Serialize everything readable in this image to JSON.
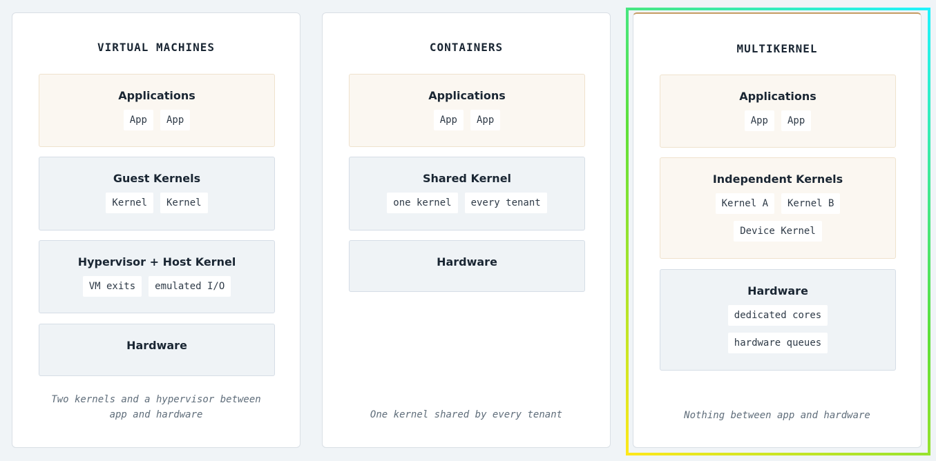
{
  "columns": [
    {
      "title": "VIRTUAL MACHINES",
      "layers": [
        {
          "title": "Applications",
          "chips": [
            "App",
            "App"
          ]
        },
        {
          "title": "Guest Kernels",
          "chips": [
            "Kernel",
            "Kernel"
          ]
        },
        {
          "title": "Hypervisor + Host Kernel",
          "chips": [
            "VM exits",
            "emulated I/O"
          ]
        },
        {
          "title": "Hardware",
          "chips": []
        }
      ],
      "caption": "Two kernels and a hypervisor between app and hardware"
    },
    {
      "title": "CONTAINERS",
      "layers": [
        {
          "title": "Applications",
          "chips": [
            "App",
            "App"
          ]
        },
        {
          "title": "Shared Kernel",
          "chips": [
            "one kernel",
            "every tenant"
          ]
        },
        {
          "title": "Hardware",
          "chips": []
        }
      ],
      "caption": "One kernel shared by every tenant"
    },
    {
      "title": "MULTIKERNEL",
      "layers": [
        {
          "title": "Applications",
          "chips": [
            "App",
            "App"
          ]
        },
        {
          "title": "Independent Kernels",
          "chips": [
            "Kernel A",
            "Kernel B",
            "Device Kernel"
          ]
        },
        {
          "title": "Hardware",
          "chips": [
            "dedicated cores",
            "hardware queues"
          ]
        }
      ],
      "caption": "Nothing between app and hardware"
    }
  ],
  "colors": {
    "app_layer": "#fbf7f1",
    "system_layer": "#eff3f6",
    "highlight_gradient": [
      "#ffe81a",
      "#5ee03a",
      "#1ef3ff"
    ]
  }
}
